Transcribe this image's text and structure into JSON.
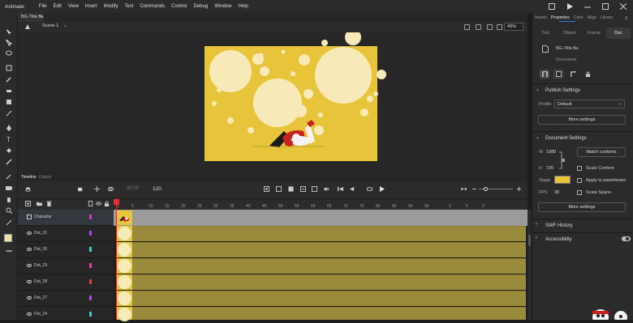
{
  "app": {
    "name": "Animate",
    "file_tab": "BG-Title.fla"
  },
  "menu": [
    "File",
    "Edit",
    "View",
    "Insert",
    "Modify",
    "Test",
    "Commands",
    "Control",
    "Debug",
    "Window",
    "Help"
  ],
  "scene": {
    "label": "Scene 1",
    "zoom": "49%"
  },
  "timeline": {
    "tabs": [
      "Timeline",
      "Output"
    ],
    "frame_display": "30.00",
    "fps_display": "120",
    "ruler": [
      "1",
      "5",
      "10",
      "15",
      "20",
      "25",
      "30",
      "35",
      "40",
      "45",
      "50",
      "55",
      "60",
      "65",
      "70",
      "75",
      "80",
      "85",
      "90",
      "95",
      "2",
      "5",
      "2"
    ],
    "layers": [
      {
        "name": "Character",
        "color": "#d633e0"
      },
      {
        "name": "Dot_31",
        "color": "#b83cff"
      },
      {
        "name": "Dot_30",
        "color": "#29d6c8"
      },
      {
        "name": "Dot_29",
        "color": "#ff2fb0"
      },
      {
        "name": "Dot_28",
        "color": "#ff3030"
      },
      {
        "name": "Dot_27",
        "color": "#b83cff"
      },
      {
        "name": "Dot_24",
        "color": "#29d6c8"
      }
    ]
  },
  "panel": {
    "tabs": [
      "Assets",
      "Properties",
      "Color",
      "Align",
      "Library"
    ],
    "sub_tabs": [
      "Tool",
      "Object",
      "Frame",
      "Doc"
    ],
    "doc_name": "BG-Title.fla",
    "doc_type": "Document",
    "publish": {
      "title": "Publish Settings",
      "profile_label": "Profile",
      "profile_value": "Default",
      "more": "More settings"
    },
    "document": {
      "title": "Document Settings",
      "w_label": "W",
      "w_value": "1080",
      "h_label": "H",
      "h_value": "720",
      "match_contents": "Match contents",
      "scale_content": "Scale Content",
      "stage_label": "Stage",
      "stage_color": "#e8c43a",
      "apply_pasteboard": "Apply to pasteboard",
      "fps_label": "FPS",
      "fps_value": "30",
      "scale_spans": "Scale Spans",
      "more": "More settings"
    },
    "swf_history": "SWF History",
    "accessibility": "Accessibility"
  },
  "colors": {
    "stage": "#e8c43a",
    "dot": "#f7eab8",
    "keyframe": "#e5c53c",
    "tween": "#9a8a3c",
    "accent": "#2f7bd6"
  }
}
